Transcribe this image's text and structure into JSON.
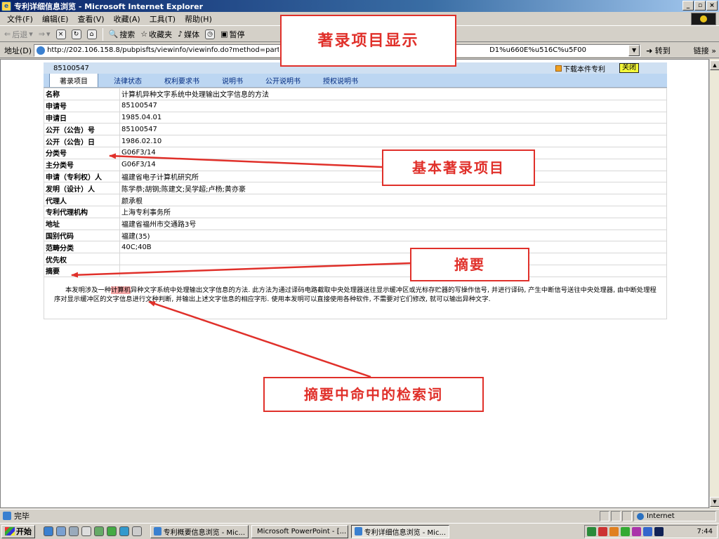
{
  "window": {
    "title": "专利详细信息浏览 - Microsoft Internet Explorer",
    "min": "_",
    "max": "▫",
    "close": "×"
  },
  "menu": [
    "文件(F)",
    "编辑(E)",
    "查看(V)",
    "收藏(A)",
    "工具(T)",
    "帮助(H)"
  ],
  "toolbar": {
    "back": "后退",
    "search": "搜索",
    "favorites": "收藏夹",
    "media": "媒体",
    "stop": "暂停"
  },
  "address": {
    "label": "地址(D)",
    "url_start": "http://202.106.158.8/pubpisfts/viewinfo/viewinfo.do?method=particular&ft=",
    "url_end": "D1%u660E%u516C%u5F00",
    "go": "转到",
    "links": "链接"
  },
  "patent": {
    "id": "85100547",
    "download": "下载本件专利",
    "close": "关闭",
    "tabs": [
      "著录项目",
      "法律状态",
      "权利要求书",
      "说明书",
      "公开说明书",
      "授权说明书"
    ],
    "fields": [
      {
        "label": "名称",
        "value": "计算机异种文字系统中处理输出文字信息的方法"
      },
      {
        "label": "申请号",
        "value": "85100547"
      },
      {
        "label": "申请日",
        "value": "1985.04.01"
      },
      {
        "label": "公开（公告）号",
        "value": "85100547"
      },
      {
        "label": "公开（公告）日",
        "value": "1986.02.10"
      },
      {
        "label": "分类号",
        "value": "G06F3/14"
      },
      {
        "label": "主分类号",
        "value": "G06F3/14"
      },
      {
        "label": "申请（专利权）人",
        "value": "福建省电子计算机研究所"
      },
      {
        "label": "发明（设计）人",
        "value": "陈学恭;胡钢;陈建文;吴学超;卢杨;黄亦豪"
      },
      {
        "label": "代理人",
        "value": "颜承根"
      },
      {
        "label": "专利代理机构",
        "value": "上海专利事务所"
      },
      {
        "label": "地址",
        "value": "福建省福州市交通路3号"
      },
      {
        "label": "国别代码",
        "value": "福建(35)"
      },
      {
        "label": "范畴分类",
        "value": "40C;40B"
      },
      {
        "label": "优先权",
        "value": ""
      },
      {
        "label": "摘要",
        "value": ""
      }
    ],
    "abstract_pre": "本发明涉及一种",
    "abstract_hit": "计算机",
    "abstract_post": "异种文字系统中处理输出文字信息的方法. 此方法为通过译码电路截取中央处理器送往显示缓冲区或光标存贮器的写操作信号, 并进行译码, 产生中断信号送往中央处理器, 由中断处理程序对显示缓冲区的文字信息进行文种判断, 并输出上述文字信息的相应字形. 使用本发明可以直接使用各种软件, 不需要对它们修改, 就可以输出异种文字."
  },
  "callouts": {
    "top": "著录项目显示",
    "basic": "基本著录项目",
    "abstract": "摘要",
    "hit": "摘要中命中的检索词"
  },
  "callout_color": "#e0302a",
  "status": {
    "text": "完毕",
    "zone": "Internet"
  },
  "taskbar": {
    "start": "开始",
    "tasks": [
      "专利概要信息浏览 - Mic...",
      "Microsoft PowerPoint - [...",
      "专利详细信息浏览 - Mic..."
    ],
    "clock": "7:44"
  }
}
